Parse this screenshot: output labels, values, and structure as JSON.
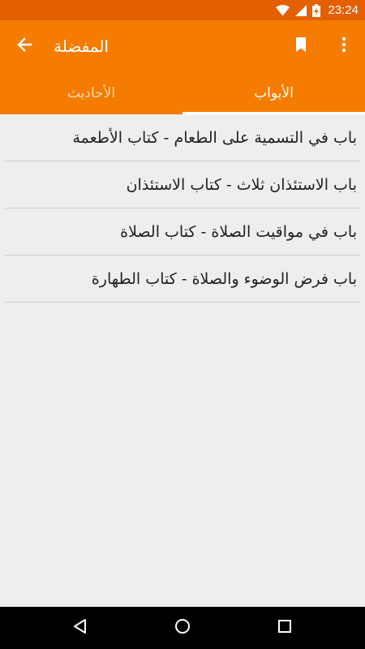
{
  "status_bar": {
    "time": "23:24"
  },
  "app_bar": {
    "title": "المفضلة"
  },
  "tabs": [
    {
      "label": "الأحاديث",
      "active": false
    },
    {
      "label": "الأبواب",
      "active": true
    }
  ],
  "list": {
    "items": [
      "باب في التسمية على الطعام - كتاب الأطعمة",
      "باب الاستئذان ثلاث - كتاب الاستئذان",
      "باب في مواقيت الصلاة - كتاب الصلاة",
      "باب فرض الوضوء والصلاة - كتاب الطهارة"
    ]
  },
  "colors": {
    "app_bar": "#f57c00",
    "status_bar": "#e45f00",
    "background": "#eeeeee"
  },
  "icons": {
    "back": "arrow-left-icon",
    "bookmark": "bookmark-icon",
    "overflow": "more-vertical-icon"
  }
}
